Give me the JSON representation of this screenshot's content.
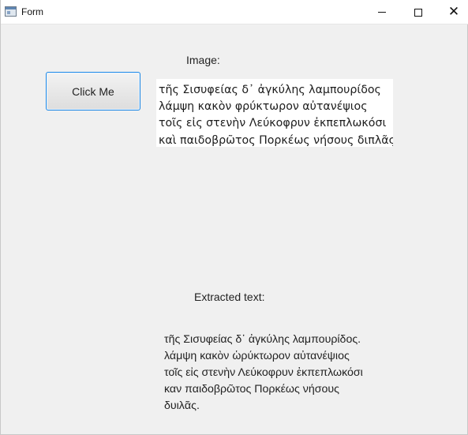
{
  "window": {
    "title": "Form",
    "icon": "application-form-icon",
    "controls": {
      "minimize": "−",
      "maximize": "☐",
      "close": "✕"
    }
  },
  "form": {
    "button_label": "Click Me",
    "image_label": "Image:",
    "image_text_lines": [
      "τῆς Σισυφείας δ᾽ ἀγκύλης λαμπουρίδος",
      "λάμψη κακὸν φρύκτωρον αὐτανέψιος",
      "τοῖς εἰς στενὴν Λεύκοφρυν ἐκπεπλωκόσι",
      "καὶ παιδοβρῶτος Πορκέως νήσους διπλᾶς"
    ],
    "extracted_label": "Extracted text:",
    "extracted_text_lines": [
      "τῆς Σισυφείας δ᾽ ἀγκύλης λαμπουρίδος.",
      "λάμψη κακὸν ὡρύκτωρον αὐτανέψιος",
      "τοῖς εἰς στενὴν Λεύκοφρυν ἐκπεπλωκόσι",
      "καν παιδοβρῶτος Πορκέως νήσους",
      "δυιλᾶς."
    ]
  }
}
